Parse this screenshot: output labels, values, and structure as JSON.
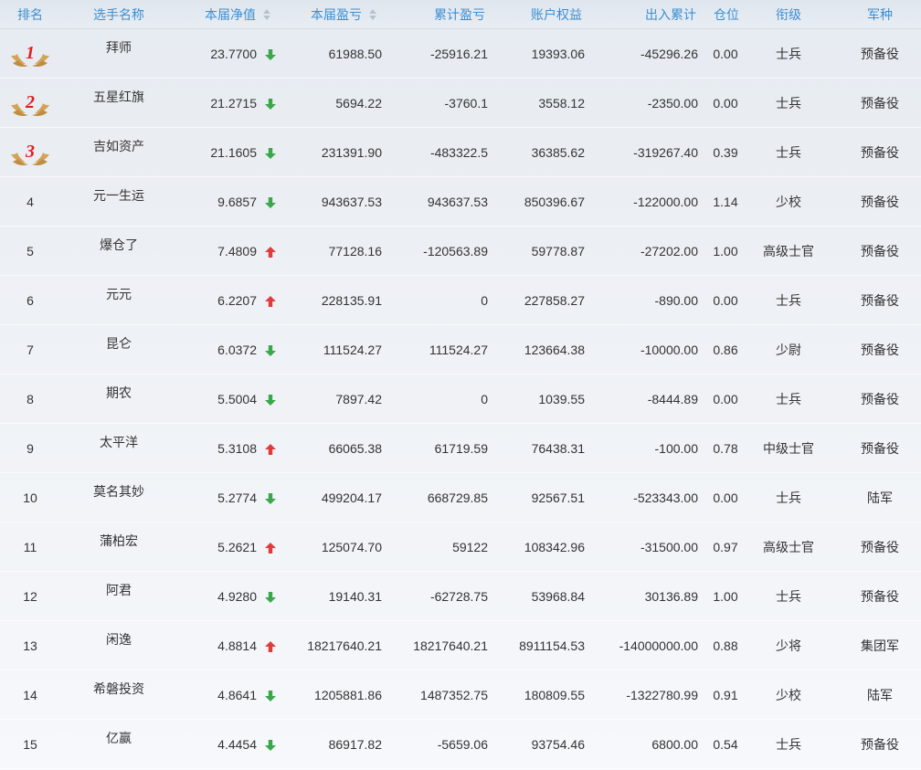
{
  "header": {
    "rank": "排名",
    "name": "选手名称",
    "nav": "本届净值",
    "pnl": "本届盈亏",
    "cum_pnl": "累计盈亏",
    "equity": "账户权益",
    "flow": "出入累计",
    "position": "仓位",
    "rank_title": "衔级",
    "branch": "军种"
  },
  "colors": {
    "header_text": "#3b8fd4",
    "up": "#e03c3c",
    "down": "#3aa84a",
    "medal": "#d2a458",
    "medal_number": "#e02020"
  },
  "rows": [
    {
      "rank": "1",
      "medal": true,
      "name": "拜师",
      "nav": "23.7700",
      "dir": "down",
      "pnl": "61988.50",
      "cum_pnl": "-25916.21",
      "equity": "19393.06",
      "flow": "-45296.26",
      "position": "0.00",
      "title": "士兵",
      "branch": "预备役"
    },
    {
      "rank": "2",
      "medal": true,
      "name": "五星红旗",
      "nav": "21.2715",
      "dir": "down",
      "pnl": "5694.22",
      "cum_pnl": "-3760.1",
      "equity": "3558.12",
      "flow": "-2350.00",
      "position": "0.00",
      "title": "士兵",
      "branch": "预备役"
    },
    {
      "rank": "3",
      "medal": true,
      "name": "吉如资产",
      "nav": "21.1605",
      "dir": "down",
      "pnl": "231391.90",
      "cum_pnl": "-483322.5",
      "equity": "36385.62",
      "flow": "-319267.40",
      "position": "0.39",
      "title": "士兵",
      "branch": "预备役"
    },
    {
      "rank": "4",
      "medal": false,
      "name": "元一生运",
      "nav": "9.6857",
      "dir": "down",
      "pnl": "943637.53",
      "cum_pnl": "943637.53",
      "equity": "850396.67",
      "flow": "-122000.00",
      "position": "1.14",
      "title": "少校",
      "branch": "预备役"
    },
    {
      "rank": "5",
      "medal": false,
      "name": "爆仓了",
      "nav": "7.4809",
      "dir": "up",
      "pnl": "77128.16",
      "cum_pnl": "-120563.89",
      "equity": "59778.87",
      "flow": "-27202.00",
      "position": "1.00",
      "title": "高级士官",
      "branch": "预备役"
    },
    {
      "rank": "6",
      "medal": false,
      "name": "元元",
      "nav": "6.2207",
      "dir": "up",
      "pnl": "228135.91",
      "cum_pnl": "0",
      "equity": "227858.27",
      "flow": "-890.00",
      "position": "0.00",
      "title": "士兵",
      "branch": "预备役"
    },
    {
      "rank": "7",
      "medal": false,
      "name": "昆仑",
      "nav": "6.0372",
      "dir": "down",
      "pnl": "111524.27",
      "cum_pnl": "111524.27",
      "equity": "123664.38",
      "flow": "-10000.00",
      "position": "0.86",
      "title": "少尉",
      "branch": "预备役"
    },
    {
      "rank": "8",
      "medal": false,
      "name": "期农",
      "nav": "5.5004",
      "dir": "down",
      "pnl": "7897.42",
      "cum_pnl": "0",
      "equity": "1039.55",
      "flow": "-8444.89",
      "position": "0.00",
      "title": "士兵",
      "branch": "预备役"
    },
    {
      "rank": "9",
      "medal": false,
      "name": "太平洋",
      "nav": "5.3108",
      "dir": "up",
      "pnl": "66065.38",
      "cum_pnl": "61719.59",
      "equity": "76438.31",
      "flow": "-100.00",
      "position": "0.78",
      "title": "中级士官",
      "branch": "预备役"
    },
    {
      "rank": "10",
      "medal": false,
      "name": "莫名其妙",
      "nav": "5.2774",
      "dir": "down",
      "pnl": "499204.17",
      "cum_pnl": "668729.85",
      "equity": "92567.51",
      "flow": "-523343.00",
      "position": "0.00",
      "title": "士兵",
      "branch": "陆军"
    },
    {
      "rank": "11",
      "medal": false,
      "name": "蒲柏宏",
      "nav": "5.2621",
      "dir": "up",
      "pnl": "125074.70",
      "cum_pnl": "59122",
      "equity": "108342.96",
      "flow": "-31500.00",
      "position": "0.97",
      "title": "高级士官",
      "branch": "预备役"
    },
    {
      "rank": "12",
      "medal": false,
      "name": "阿君",
      "nav": "4.9280",
      "dir": "down",
      "pnl": "19140.31",
      "cum_pnl": "-62728.75",
      "equity": "53968.84",
      "flow": "30136.89",
      "position": "1.00",
      "title": "士兵",
      "branch": "预备役"
    },
    {
      "rank": "13",
      "medal": false,
      "name": "闲逸",
      "nav": "4.8814",
      "dir": "up",
      "pnl": "18217640.21",
      "cum_pnl": "18217640.21",
      "equity": "8911154.53",
      "flow": "-14000000.00",
      "position": "0.88",
      "title": "少将",
      "branch": "集团军"
    },
    {
      "rank": "14",
      "medal": false,
      "name": "希磐投资",
      "nav": "4.8641",
      "dir": "down",
      "pnl": "1205881.86",
      "cum_pnl": "1487352.75",
      "equity": "180809.55",
      "flow": "-1322780.99",
      "position": "0.91",
      "title": "少校",
      "branch": "陆军"
    },
    {
      "rank": "15",
      "medal": false,
      "name": "亿赢",
      "nav": "4.4454",
      "dir": "down",
      "pnl": "86917.82",
      "cum_pnl": "-5659.06",
      "equity": "93754.46",
      "flow": "6800.00",
      "position": "0.54",
      "title": "士兵",
      "branch": "预备役"
    }
  ]
}
